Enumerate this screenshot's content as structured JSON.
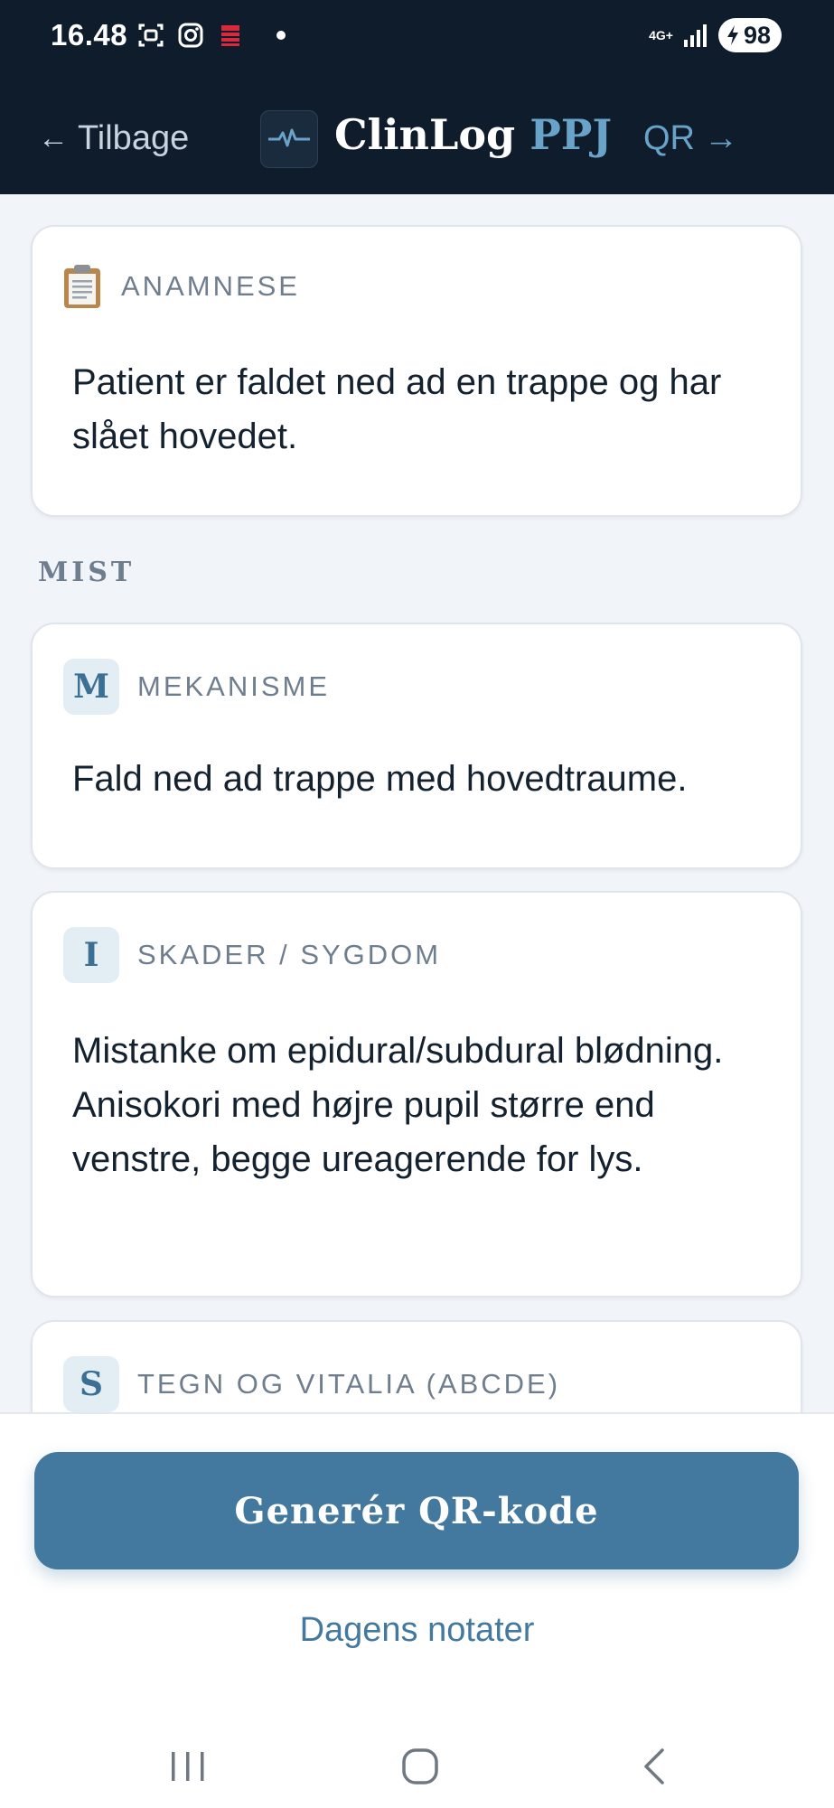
{
  "status_bar": {
    "time": "16.48",
    "network": "4G+",
    "battery": "98"
  },
  "app_bar": {
    "back_label": "Tilbage",
    "title_main": "ClinLog",
    "title_accent": "PPJ",
    "qr_label": "QR"
  },
  "anamnese": {
    "label": "ANAMNESE",
    "text": "Patient er faldet ned ad en trappe og har slået hovedet."
  },
  "mist": {
    "section_title": "MIST",
    "cards": [
      {
        "letter": "M",
        "label": "MEKANISME",
        "text": "Fald ned ad trappe med hovedtraume."
      },
      {
        "letter": "I",
        "label": "SKADER / SYGDOM",
        "text": "Mistanke om epidural/subdural blødning. Anisokori med højre pupil større end venstre, begge ureagerende for lys."
      },
      {
        "letter": "S",
        "label": "TEGN OG VITALIA (ABCDE)",
        "text": ""
      }
    ]
  },
  "actions": {
    "generate_qr": "Generér QR-kode",
    "daily_notes": "Dagens notater"
  }
}
